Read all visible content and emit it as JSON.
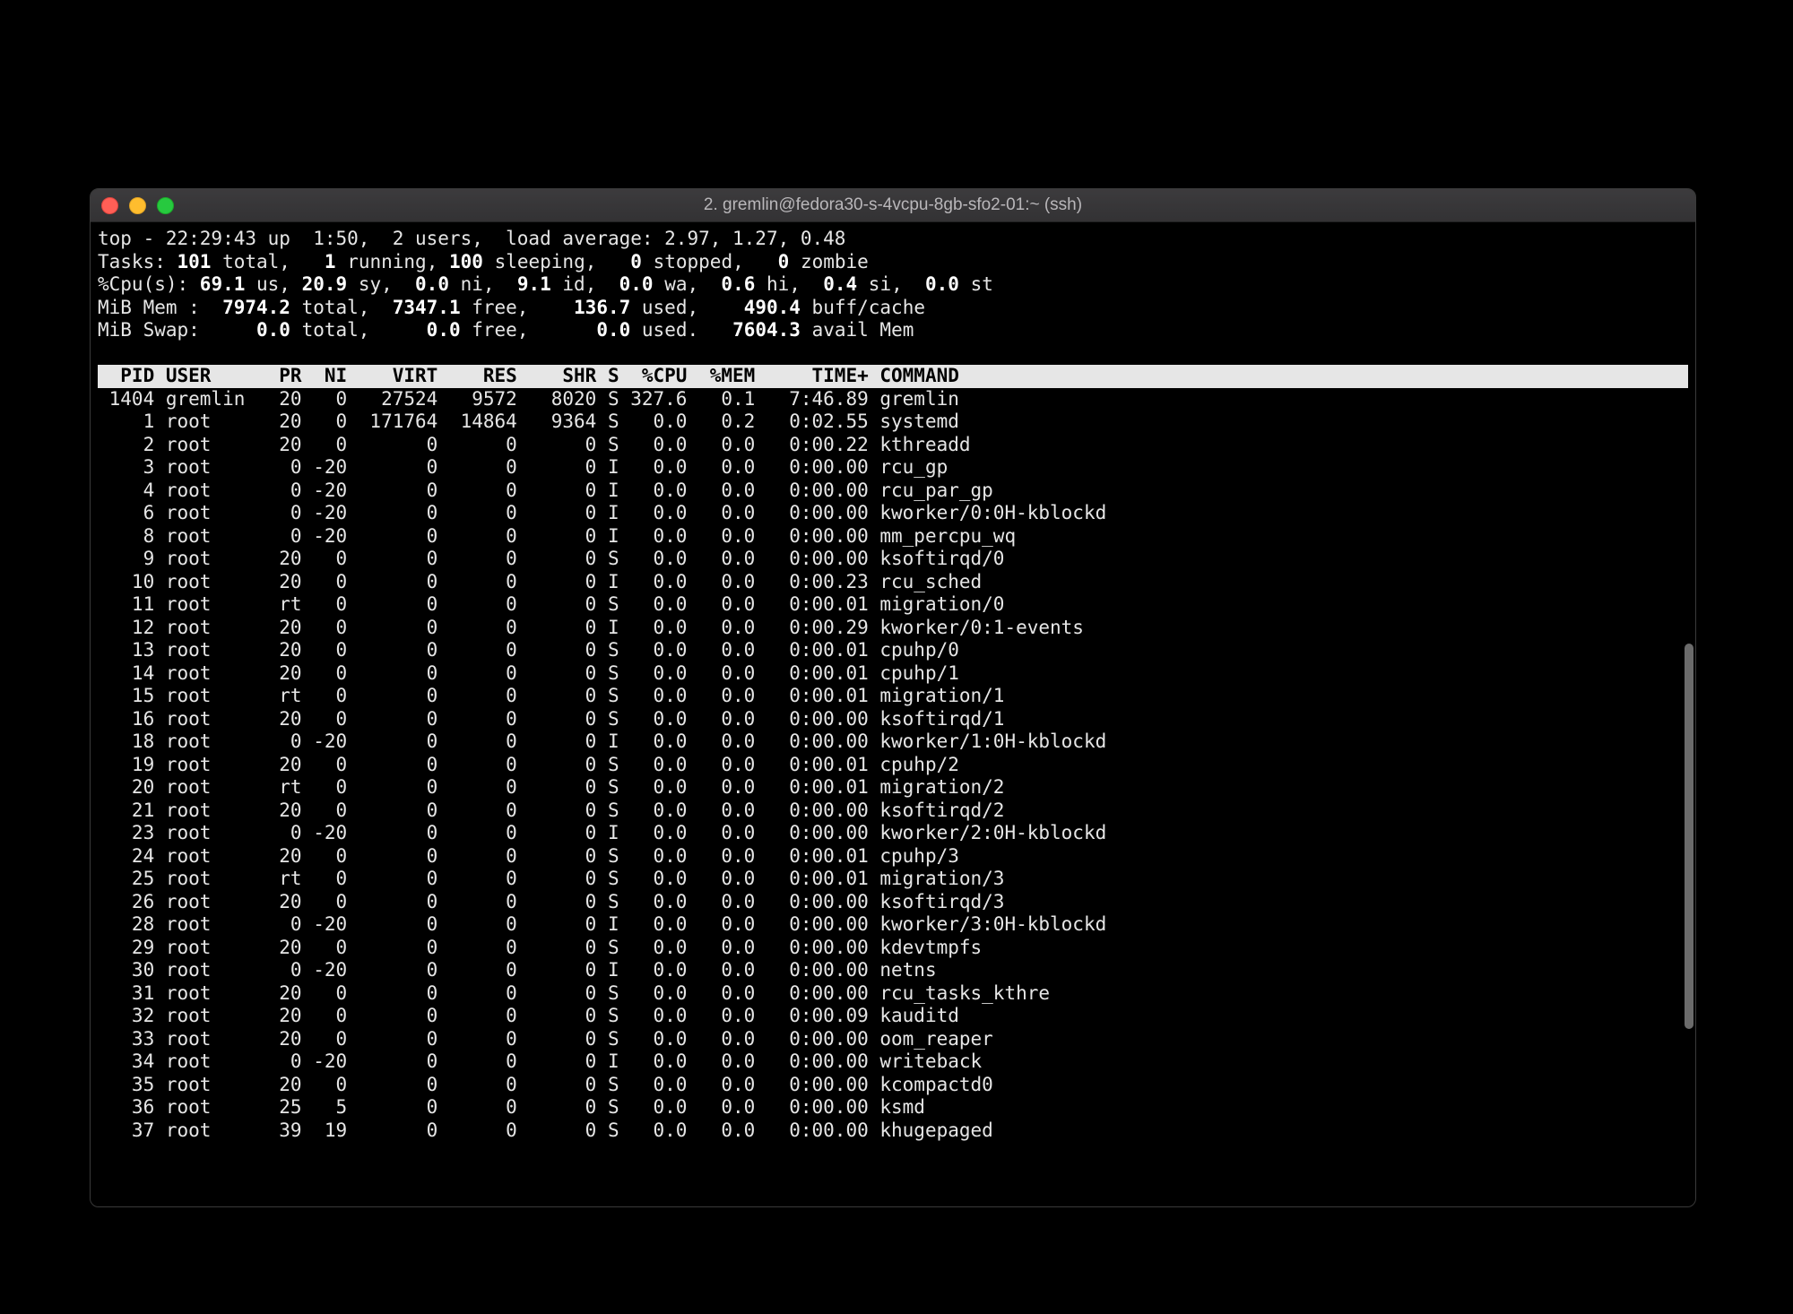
{
  "window": {
    "title": "2. gremlin@fedora30-s-4vcpu-8gb-sfo2-01:~ (ssh)"
  },
  "summary": {
    "line1_prefix": "top - 22:29:43 up  1:50,  2 users,  load average: 2.97, 1.27, 0.48",
    "tasks": {
      "label": "Tasks:",
      "total": "101",
      "total_lbl": " total,   ",
      "running": "1",
      "running_lbl": " running, ",
      "sleeping": "100",
      "sleeping_lbl": " sleeping,   ",
      "stopped": "0",
      "stopped_lbl": " stopped,   ",
      "zombie": "0",
      "zombie_lbl": " zombie"
    },
    "cpu": {
      "label": "%Cpu(s): ",
      "us": "69.1",
      "us_lbl": " us, ",
      "sy": "20.9",
      "sy_lbl": " sy,  ",
      "ni": "0.0",
      "ni_lbl": " ni,  ",
      "id": "9.1",
      "id_lbl": " id,  ",
      "wa": "0.0",
      "wa_lbl": " wa,  ",
      "hi": "0.6",
      "hi_lbl": " hi,  ",
      "si": "0.4",
      "si_lbl": " si,  ",
      "st": "0.0",
      "st_lbl": " st"
    },
    "mem": {
      "label": "MiB Mem :  ",
      "total": "7974.2",
      "total_lbl": " total,  ",
      "free": "7347.1",
      "free_lbl": " free,    ",
      "used": "136.7",
      "used_lbl": " used,    ",
      "buff": "490.4",
      "buff_lbl": " buff/cache"
    },
    "swap": {
      "label": "MiB Swap:     ",
      "total": "0.0",
      "total_lbl": " total,     ",
      "free": "0.0",
      "free_lbl": " free,      ",
      "used": "0.0",
      "used_lbl": " used.   ",
      "avail": "7604.3",
      "avail_lbl": " avail Mem"
    }
  },
  "columns": "  PID USER      PR  NI    VIRT    RES    SHR S  %CPU  %MEM     TIME+ COMMAND",
  "processes": [
    {
      "pid": "1404",
      "user": "gremlin",
      "pr": "20",
      "ni": "0",
      "virt": "27524",
      "res": "9572",
      "shr": "8020",
      "s": "S",
      "cpu": "327.6",
      "mem": "0.1",
      "time": "7:46.89",
      "cmd": "gremlin"
    },
    {
      "pid": "1",
      "user": "root",
      "pr": "20",
      "ni": "0",
      "virt": "171764",
      "res": "14864",
      "shr": "9364",
      "s": "S",
      "cpu": "0.0",
      "mem": "0.2",
      "time": "0:02.55",
      "cmd": "systemd"
    },
    {
      "pid": "2",
      "user": "root",
      "pr": "20",
      "ni": "0",
      "virt": "0",
      "res": "0",
      "shr": "0",
      "s": "S",
      "cpu": "0.0",
      "mem": "0.0",
      "time": "0:00.22",
      "cmd": "kthreadd"
    },
    {
      "pid": "3",
      "user": "root",
      "pr": "0",
      "ni": "-20",
      "virt": "0",
      "res": "0",
      "shr": "0",
      "s": "I",
      "cpu": "0.0",
      "mem": "0.0",
      "time": "0:00.00",
      "cmd": "rcu_gp"
    },
    {
      "pid": "4",
      "user": "root",
      "pr": "0",
      "ni": "-20",
      "virt": "0",
      "res": "0",
      "shr": "0",
      "s": "I",
      "cpu": "0.0",
      "mem": "0.0",
      "time": "0:00.00",
      "cmd": "rcu_par_gp"
    },
    {
      "pid": "6",
      "user": "root",
      "pr": "0",
      "ni": "-20",
      "virt": "0",
      "res": "0",
      "shr": "0",
      "s": "I",
      "cpu": "0.0",
      "mem": "0.0",
      "time": "0:00.00",
      "cmd": "kworker/0:0H-kblockd"
    },
    {
      "pid": "8",
      "user": "root",
      "pr": "0",
      "ni": "-20",
      "virt": "0",
      "res": "0",
      "shr": "0",
      "s": "I",
      "cpu": "0.0",
      "mem": "0.0",
      "time": "0:00.00",
      "cmd": "mm_percpu_wq"
    },
    {
      "pid": "9",
      "user": "root",
      "pr": "20",
      "ni": "0",
      "virt": "0",
      "res": "0",
      "shr": "0",
      "s": "S",
      "cpu": "0.0",
      "mem": "0.0",
      "time": "0:00.00",
      "cmd": "ksoftirqd/0"
    },
    {
      "pid": "10",
      "user": "root",
      "pr": "20",
      "ni": "0",
      "virt": "0",
      "res": "0",
      "shr": "0",
      "s": "I",
      "cpu": "0.0",
      "mem": "0.0",
      "time": "0:00.23",
      "cmd": "rcu_sched"
    },
    {
      "pid": "11",
      "user": "root",
      "pr": "rt",
      "ni": "0",
      "virt": "0",
      "res": "0",
      "shr": "0",
      "s": "S",
      "cpu": "0.0",
      "mem": "0.0",
      "time": "0:00.01",
      "cmd": "migration/0"
    },
    {
      "pid": "12",
      "user": "root",
      "pr": "20",
      "ni": "0",
      "virt": "0",
      "res": "0",
      "shr": "0",
      "s": "I",
      "cpu": "0.0",
      "mem": "0.0",
      "time": "0:00.29",
      "cmd": "kworker/0:1-events"
    },
    {
      "pid": "13",
      "user": "root",
      "pr": "20",
      "ni": "0",
      "virt": "0",
      "res": "0",
      "shr": "0",
      "s": "S",
      "cpu": "0.0",
      "mem": "0.0",
      "time": "0:00.01",
      "cmd": "cpuhp/0"
    },
    {
      "pid": "14",
      "user": "root",
      "pr": "20",
      "ni": "0",
      "virt": "0",
      "res": "0",
      "shr": "0",
      "s": "S",
      "cpu": "0.0",
      "mem": "0.0",
      "time": "0:00.01",
      "cmd": "cpuhp/1"
    },
    {
      "pid": "15",
      "user": "root",
      "pr": "rt",
      "ni": "0",
      "virt": "0",
      "res": "0",
      "shr": "0",
      "s": "S",
      "cpu": "0.0",
      "mem": "0.0",
      "time": "0:00.01",
      "cmd": "migration/1"
    },
    {
      "pid": "16",
      "user": "root",
      "pr": "20",
      "ni": "0",
      "virt": "0",
      "res": "0",
      "shr": "0",
      "s": "S",
      "cpu": "0.0",
      "mem": "0.0",
      "time": "0:00.00",
      "cmd": "ksoftirqd/1"
    },
    {
      "pid": "18",
      "user": "root",
      "pr": "0",
      "ni": "-20",
      "virt": "0",
      "res": "0",
      "shr": "0",
      "s": "I",
      "cpu": "0.0",
      "mem": "0.0",
      "time": "0:00.00",
      "cmd": "kworker/1:0H-kblockd"
    },
    {
      "pid": "19",
      "user": "root",
      "pr": "20",
      "ni": "0",
      "virt": "0",
      "res": "0",
      "shr": "0",
      "s": "S",
      "cpu": "0.0",
      "mem": "0.0",
      "time": "0:00.01",
      "cmd": "cpuhp/2"
    },
    {
      "pid": "20",
      "user": "root",
      "pr": "rt",
      "ni": "0",
      "virt": "0",
      "res": "0",
      "shr": "0",
      "s": "S",
      "cpu": "0.0",
      "mem": "0.0",
      "time": "0:00.01",
      "cmd": "migration/2"
    },
    {
      "pid": "21",
      "user": "root",
      "pr": "20",
      "ni": "0",
      "virt": "0",
      "res": "0",
      "shr": "0",
      "s": "S",
      "cpu": "0.0",
      "mem": "0.0",
      "time": "0:00.00",
      "cmd": "ksoftirqd/2"
    },
    {
      "pid": "23",
      "user": "root",
      "pr": "0",
      "ni": "-20",
      "virt": "0",
      "res": "0",
      "shr": "0",
      "s": "I",
      "cpu": "0.0",
      "mem": "0.0",
      "time": "0:00.00",
      "cmd": "kworker/2:0H-kblockd"
    },
    {
      "pid": "24",
      "user": "root",
      "pr": "20",
      "ni": "0",
      "virt": "0",
      "res": "0",
      "shr": "0",
      "s": "S",
      "cpu": "0.0",
      "mem": "0.0",
      "time": "0:00.01",
      "cmd": "cpuhp/3"
    },
    {
      "pid": "25",
      "user": "root",
      "pr": "rt",
      "ni": "0",
      "virt": "0",
      "res": "0",
      "shr": "0",
      "s": "S",
      "cpu": "0.0",
      "mem": "0.0",
      "time": "0:00.01",
      "cmd": "migration/3"
    },
    {
      "pid": "26",
      "user": "root",
      "pr": "20",
      "ni": "0",
      "virt": "0",
      "res": "0",
      "shr": "0",
      "s": "S",
      "cpu": "0.0",
      "mem": "0.0",
      "time": "0:00.00",
      "cmd": "ksoftirqd/3"
    },
    {
      "pid": "28",
      "user": "root",
      "pr": "0",
      "ni": "-20",
      "virt": "0",
      "res": "0",
      "shr": "0",
      "s": "I",
      "cpu": "0.0",
      "mem": "0.0",
      "time": "0:00.00",
      "cmd": "kworker/3:0H-kblockd"
    },
    {
      "pid": "29",
      "user": "root",
      "pr": "20",
      "ni": "0",
      "virt": "0",
      "res": "0",
      "shr": "0",
      "s": "S",
      "cpu": "0.0",
      "mem": "0.0",
      "time": "0:00.00",
      "cmd": "kdevtmpfs"
    },
    {
      "pid": "30",
      "user": "root",
      "pr": "0",
      "ni": "-20",
      "virt": "0",
      "res": "0",
      "shr": "0",
      "s": "I",
      "cpu": "0.0",
      "mem": "0.0",
      "time": "0:00.00",
      "cmd": "netns"
    },
    {
      "pid": "31",
      "user": "root",
      "pr": "20",
      "ni": "0",
      "virt": "0",
      "res": "0",
      "shr": "0",
      "s": "S",
      "cpu": "0.0",
      "mem": "0.0",
      "time": "0:00.00",
      "cmd": "rcu_tasks_kthre"
    },
    {
      "pid": "32",
      "user": "root",
      "pr": "20",
      "ni": "0",
      "virt": "0",
      "res": "0",
      "shr": "0",
      "s": "S",
      "cpu": "0.0",
      "mem": "0.0",
      "time": "0:00.09",
      "cmd": "kauditd"
    },
    {
      "pid": "33",
      "user": "root",
      "pr": "20",
      "ni": "0",
      "virt": "0",
      "res": "0",
      "shr": "0",
      "s": "S",
      "cpu": "0.0",
      "mem": "0.0",
      "time": "0:00.00",
      "cmd": "oom_reaper"
    },
    {
      "pid": "34",
      "user": "root",
      "pr": "0",
      "ni": "-20",
      "virt": "0",
      "res": "0",
      "shr": "0",
      "s": "I",
      "cpu": "0.0",
      "mem": "0.0",
      "time": "0:00.00",
      "cmd": "writeback"
    },
    {
      "pid": "35",
      "user": "root",
      "pr": "20",
      "ni": "0",
      "virt": "0",
      "res": "0",
      "shr": "0",
      "s": "S",
      "cpu": "0.0",
      "mem": "0.0",
      "time": "0:00.00",
      "cmd": "kcompactd0"
    },
    {
      "pid": "36",
      "user": "root",
      "pr": "25",
      "ni": "5",
      "virt": "0",
      "res": "0",
      "shr": "0",
      "s": "S",
      "cpu": "0.0",
      "mem": "0.0",
      "time": "0:00.00",
      "cmd": "ksmd"
    },
    {
      "pid": "37",
      "user": "root",
      "pr": "39",
      "ni": "19",
      "virt": "0",
      "res": "0",
      "shr": "0",
      "s": "S",
      "cpu": "0.0",
      "mem": "0.0",
      "time": "0:00.00",
      "cmd": "khugepaged"
    }
  ]
}
